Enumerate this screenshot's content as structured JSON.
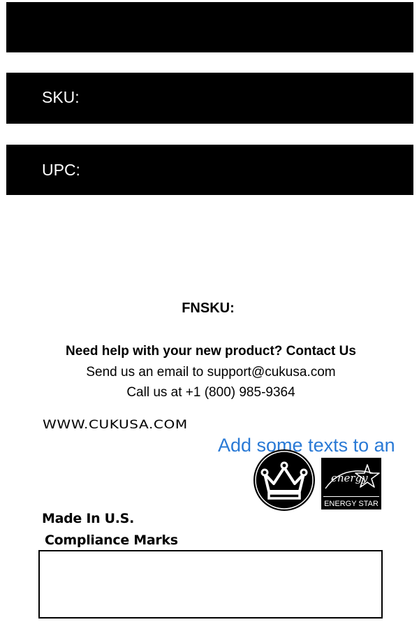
{
  "labels": {
    "title_bar_text": "",
    "sku_label": "SKU:",
    "upc_label": "UPC:",
    "fnsku_label": "FNSKU:"
  },
  "support": {
    "heading": "Need help with your new product? Contact Us",
    "email_line": "Send us an email to support@cukusa.com",
    "phone_line": "Call us at +1 (800) 985-9364"
  },
  "website": "WWW.CUKUSA.COM",
  "textbox_hint": "Add some texts to an",
  "logos": {
    "crown_icon": "crown-icon",
    "energy_star_script": "energy",
    "energy_star_label": "ENERGY STAR"
  },
  "origin": "Made In U.S.",
  "compliance_heading": "Compliance Marks",
  "colors": {
    "bar": "#000000",
    "bar_text": "#ffffff",
    "hint_text": "#2a7ad6"
  }
}
